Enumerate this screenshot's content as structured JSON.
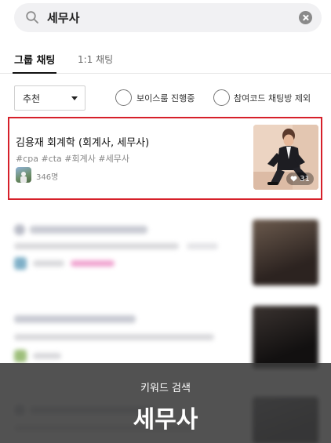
{
  "search": {
    "query": "세무사"
  },
  "tabs": [
    {
      "label": "그룹 채팅",
      "active": true
    },
    {
      "label": "1:1 채팅",
      "active": false
    }
  ],
  "filters": {
    "sort_selected": "추천",
    "options": [
      "보이스룸 진행중",
      "참여코드 채팅방 제외"
    ]
  },
  "result": {
    "title": "김용재 회계학 (회계사, 세무사)",
    "tags": "#cpa #cta #회계사 #세무사",
    "members": "346명",
    "likes": "31"
  },
  "overlay": {
    "subtitle": "키워드 검색",
    "keyword": "세무사"
  },
  "colors": {
    "highlight_border": "#d6202a",
    "overlay_bg": "#3a3a3a"
  },
  "icons": [
    "search-icon",
    "clear-icon",
    "chevron-down-icon",
    "heart-icon"
  ]
}
